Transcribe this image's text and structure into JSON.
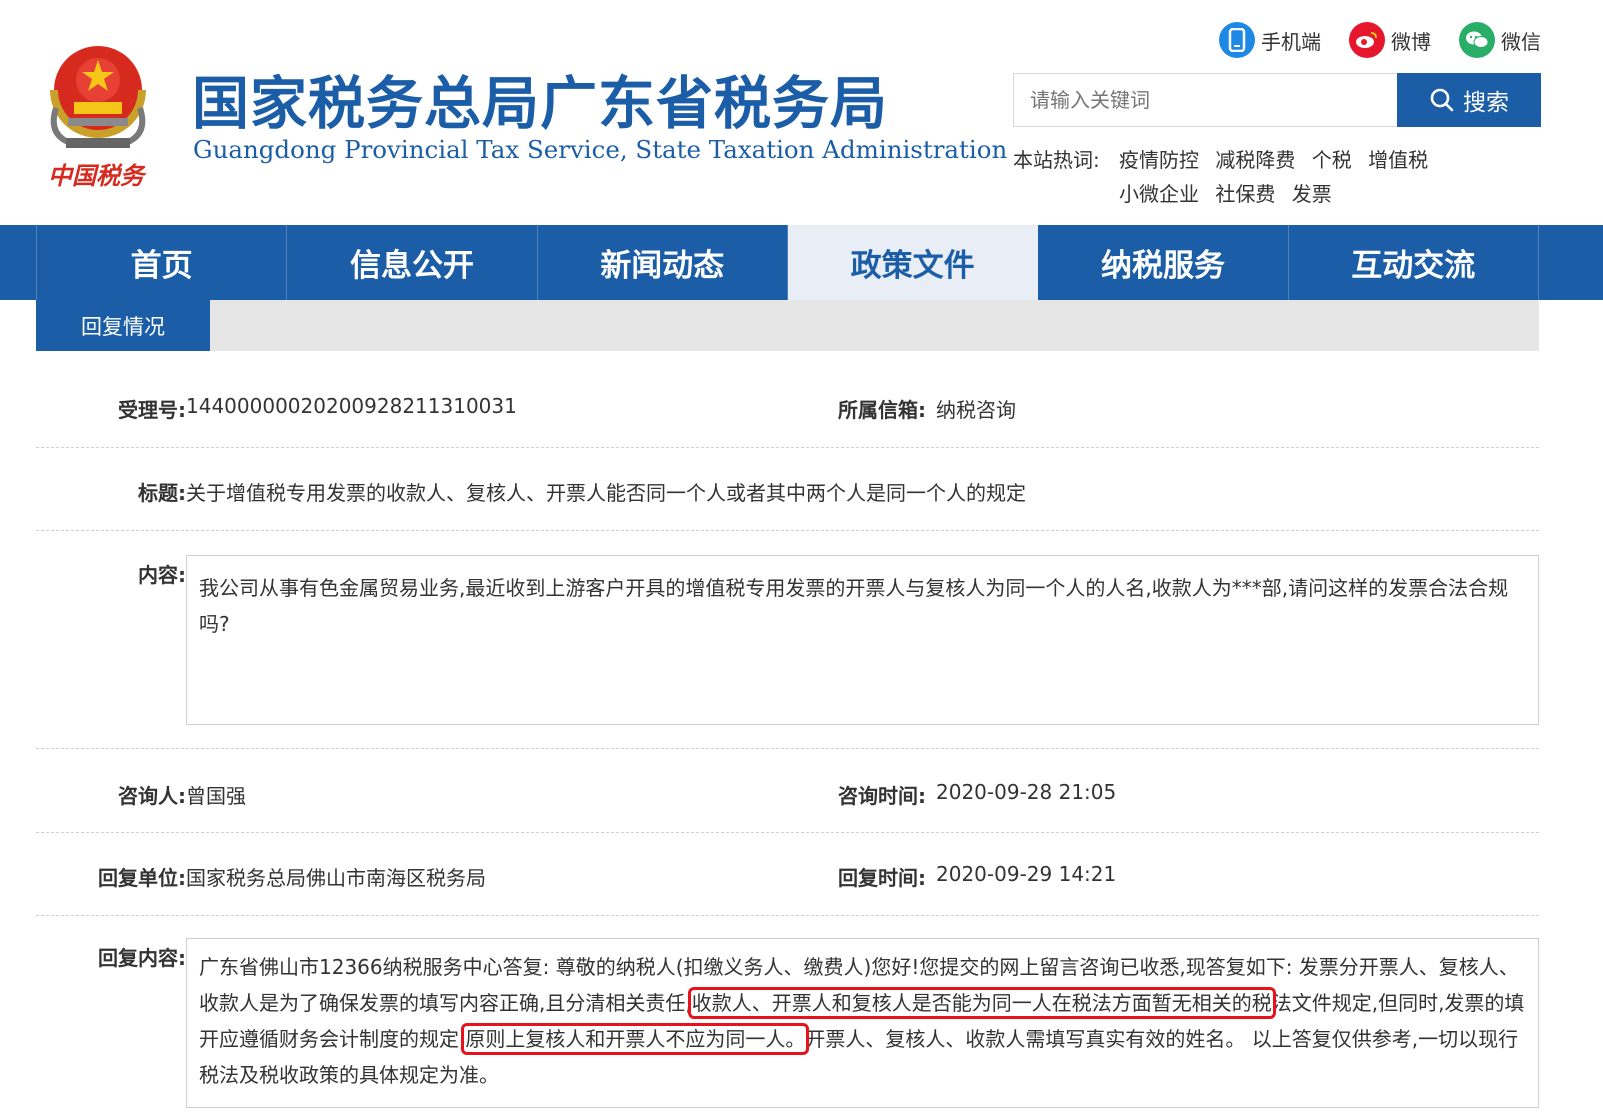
{
  "header": {
    "title": "国家税务总局广东省税务局",
    "subtitle": "Guangdong Provincial Tax Service, State Taxation Administration",
    "emblem_caption": "中国税务"
  },
  "social": [
    {
      "label": "手机端",
      "icon": "mobile-icon",
      "color": "#1e88e5"
    },
    {
      "label": "微博",
      "icon": "weibo-icon",
      "color": "#e6162d"
    },
    {
      "label": "微信",
      "icon": "wechat-icon",
      "color": "#2aae67"
    }
  ],
  "search": {
    "placeholder": "请输入关键词",
    "button_label": "搜索"
  },
  "hot": {
    "label": "本站热词:",
    "words": [
      "疫情防控",
      "减税降费",
      "个税",
      "增值税",
      "小微企业",
      "社保费",
      "发票"
    ]
  },
  "nav": [
    "首页",
    "信息公开",
    "新闻动态",
    "政策文件",
    "纳税服务",
    "互动交流"
  ],
  "nav_active": "政策文件",
  "subtab": "回复情况",
  "detail": {
    "accept_no_label": "受理号:",
    "accept_no": "14400000020200928211310031",
    "mailbox_label": "所属信箱:",
    "mailbox": "纳税咨询",
    "title_label": "标题:",
    "title": "关于增值税专用发票的收款人、复核人、开票人能否同一个人或者其中两个人是同一个人的规定",
    "content_label": "内容:",
    "content": "我公司从事有色金属贸易业务,最近收到上游客户开具的增值税专用发票的开票人与复核人为同一个人的人名,收款人为***部,请问这样的发票合法合规吗?",
    "asker_label": "咨询人:",
    "asker": "曾国强",
    "ask_time_label": "咨询时间:",
    "ask_time": "2020-09-28 21:05",
    "reply_unit_label": "回复单位:",
    "reply_unit": "国家税务总局佛山市南海区税务局",
    "reply_time_label": "回复时间:",
    "reply_time": "2020-09-29 14:21",
    "reply_label": "回复内容:",
    "reply_part1": "广东省佛山市12366纳税服务中心答复: 尊敬的纳税人(扣缴义务人、缴费人)您好!您提交的网上留言咨询已收悉,现答复如下: 发票分开票人、复核人、收款人是为了确保发票的填写内容正确,且分清相关责任,",
    "reply_highlight1": "收款人、开票人和复核人是否能为同一人在税法方面暂无相关的税",
    "reply_part2": "法文件规定,但同时,发票的填开应遵循财务会计制度的规定,",
    "reply_highlight2": "原则上复核人和开票人不应为同一人。",
    "reply_part3": "开票人、复核人、收款人需填写真实有效的姓名。 以上答复仅供参考,一切以现行税法及税收政策的具体规定为准。"
  }
}
